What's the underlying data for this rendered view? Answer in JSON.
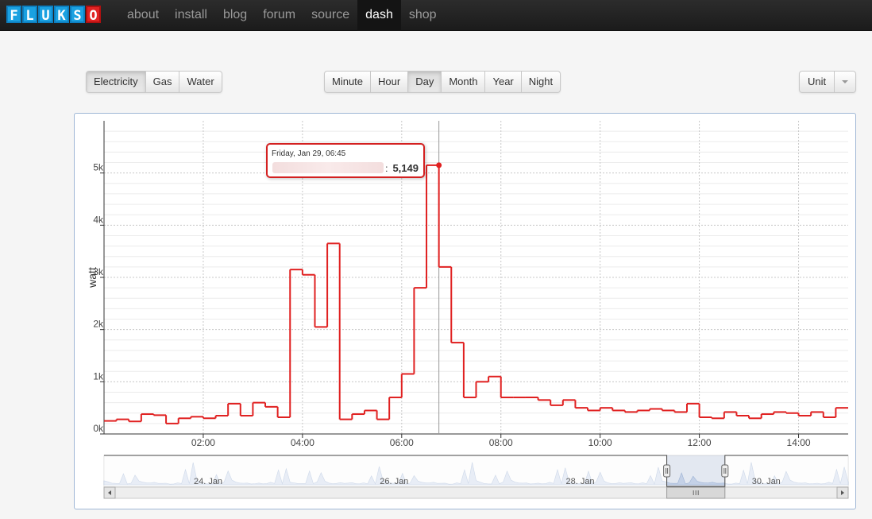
{
  "nav": {
    "logo_letters": [
      "F",
      "L",
      "U",
      "K",
      "S",
      "O"
    ],
    "links": [
      {
        "label": "about"
      },
      {
        "label": "install"
      },
      {
        "label": "blog"
      },
      {
        "label": "forum"
      },
      {
        "label": "source"
      },
      {
        "label": "dash",
        "active": true
      },
      {
        "label": "shop"
      }
    ]
  },
  "type_buttons": [
    "Electricity",
    "Gas",
    "Water"
  ],
  "type_active": "Electricity",
  "period_buttons": [
    "Minute",
    "Hour",
    "Day",
    "Month",
    "Year",
    "Night"
  ],
  "period_active": "Day",
  "unit_button": "Unit",
  "colors": {
    "series": "#e02020",
    "navigator_fill": "#c9d6ea",
    "navigator_line": "#8aa4cc"
  },
  "tooltip": {
    "date": "Friday, Jan 29, 06:45",
    "separator": ":",
    "value": "5,149"
  },
  "chart_data": {
    "type": "line",
    "step": true,
    "ylabel": "watt",
    "xlabel": "",
    "ylim": [
      0,
      6000
    ],
    "x_unit": "hours since 00:00, Jan 29",
    "x_range": [
      0.0,
      15.0
    ],
    "x_ticks": [
      {
        "x": 2,
        "label": "02:00"
      },
      {
        "x": 4,
        "label": "04:00"
      },
      {
        "x": 6,
        "label": "06:00"
      },
      {
        "x": 8,
        "label": "08:00"
      },
      {
        "x": 10,
        "label": "10:00"
      },
      {
        "x": 12,
        "label": "12:00"
      },
      {
        "x": 14,
        "label": "14:00"
      }
    ],
    "y_ticks": [
      {
        "y": 0,
        "label": "0k"
      },
      {
        "y": 1000,
        "label": "1k"
      },
      {
        "y": 2000,
        "label": "2k"
      },
      {
        "y": 3000,
        "label": "3k"
      },
      {
        "y": 4000,
        "label": "4k"
      },
      {
        "y": 5000,
        "label": "5k"
      }
    ],
    "grid": true,
    "highlight": {
      "x": 6.75,
      "y": 5149
    },
    "series": [
      {
        "x": [
          0,
          0.25,
          0.5,
          0.75,
          1,
          1.25,
          1.5,
          1.75,
          2,
          2.25,
          2.5,
          2.75,
          3,
          3.25,
          3.5,
          3.75,
          4,
          4.25,
          4.5,
          4.75,
          5,
          5.25,
          5.5,
          5.75,
          6,
          6.25,
          6.5,
          6.75,
          7,
          7.25,
          7.5,
          7.75,
          8,
          8.25,
          8.5,
          8.75,
          9,
          9.25,
          9.5,
          9.75,
          10,
          10.25,
          10.5,
          10.75,
          11,
          11.25,
          11.5,
          11.75,
          12,
          12.25,
          12.5,
          12.75,
          13,
          13.25,
          13.5,
          13.75,
          14,
          14.25,
          14.5,
          14.75,
          15
        ],
        "values": [
          250,
          280,
          240,
          380,
          360,
          200,
          300,
          330,
          300,
          350,
          580,
          350,
          600,
          520,
          320,
          3150,
          3050,
          2050,
          3650,
          280,
          380,
          450,
          280,
          700,
          1150,
          2800,
          5149,
          3200,
          1750,
          700,
          1000,
          1100,
          700,
          700,
          700,
          650,
          550,
          650,
          500,
          450,
          500,
          450,
          420,
          450,
          480,
          450,
          420,
          580,
          320,
          300,
          420,
          350,
          300,
          380,
          420,
          400,
          350,
          420,
          320,
          500,
          500
        ]
      }
    ],
    "navigator": {
      "labels": [
        "24. Jan",
        "26. Jan",
        "28. Jan",
        "30. Jan"
      ],
      "tick_days": [
        24,
        26,
        28,
        30
      ],
      "x_range_days": [
        22.95,
        30.95
      ],
      "selection_days": [
        29.0,
        29.625
      ]
    }
  }
}
